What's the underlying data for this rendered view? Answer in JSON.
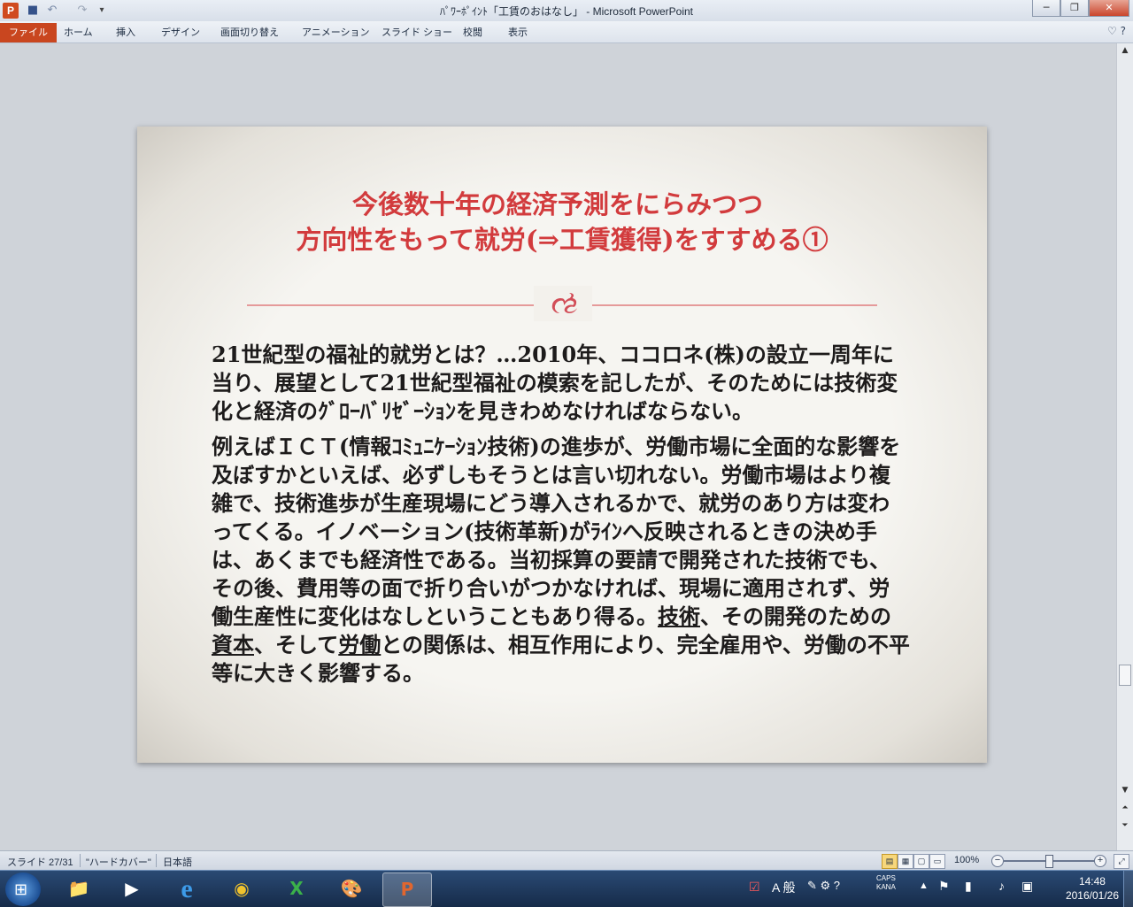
{
  "window": {
    "title": "ﾊﾟﾜｰﾎﾟｲﾝﾄ「工賃のおはなし」 - Microsoft PowerPoint",
    "app_icon_letter": "P",
    "minimize": "─",
    "restore": "❐",
    "close": "✕"
  },
  "quick_access": {
    "save": "■",
    "undo": "↶",
    "redo": "↷",
    "customize": "▾"
  },
  "ribbon": {
    "tabs": [
      "ファイル",
      "ホーム",
      "挿入",
      "デザイン",
      "画面切り替え",
      "アニメーション",
      "スライド ショー",
      "校閲",
      "表示"
    ],
    "help": "♡ ?"
  },
  "slide": {
    "title_line1": "今後数十年の経済予測をにらみつつ",
    "title_line2": "方向性をもって就労(⇒工賃獲得)をすすめる①",
    "ornament": "ઌ",
    "para1": "21世紀型の福祉的就労とは？…2010年、ココロネ(株)の設立一周年に当り、展望として21世紀型福祉の模索を記したが、そのためには技術変化と経済のｸﾞﾛｰﾊﾞﾘｾﾞｰｼｮﾝを見きわめなければならない。",
    "para2_a": "例えばＩＣＴ(情報ｺﾐｭﾆｹｰｼｮﾝ技術)の進歩が、労働市場に全面的な影響を及ぼすかといえば、必ずしもそうとは言い切れない。労働市場はより複雑で、技術進歩が生産現場にどう導入されるかで、就労のあり方は変わってくる。イノベーション(技術革新)がﾗｲﾝへ反映されるときの決め手は、あくまでも経済性である。当初採算の要請で開発された技術でも、その後、費用等の面で折り合いがつかなければ、現場に適用されず、労働生産性に変化はなしということもあり得る。",
    "u1": "技術",
    "para2_b": "、その開発のための",
    "u2": "資本",
    "para2_c": "、そして",
    "u3": "労働",
    "para2_d": "との関係は、相互作用により、完全雇用や、労働の不平等に大きく影響する。"
  },
  "statusbar": {
    "slide_num": "スライド 27/31",
    "theme": "\"ハードカバー\"",
    "language": "日本語",
    "zoom": "100%",
    "zoom_level_percent": 100
  },
  "taskbar": {
    "start": "⊞",
    "apps": [
      "📁",
      "▶",
      "e",
      "◉",
      "X",
      "🎨",
      "P"
    ],
    "ime": "A 般",
    "caps": "CAPS",
    "kana": "KANA",
    "time": "14:48",
    "date": "2016/01/26"
  }
}
